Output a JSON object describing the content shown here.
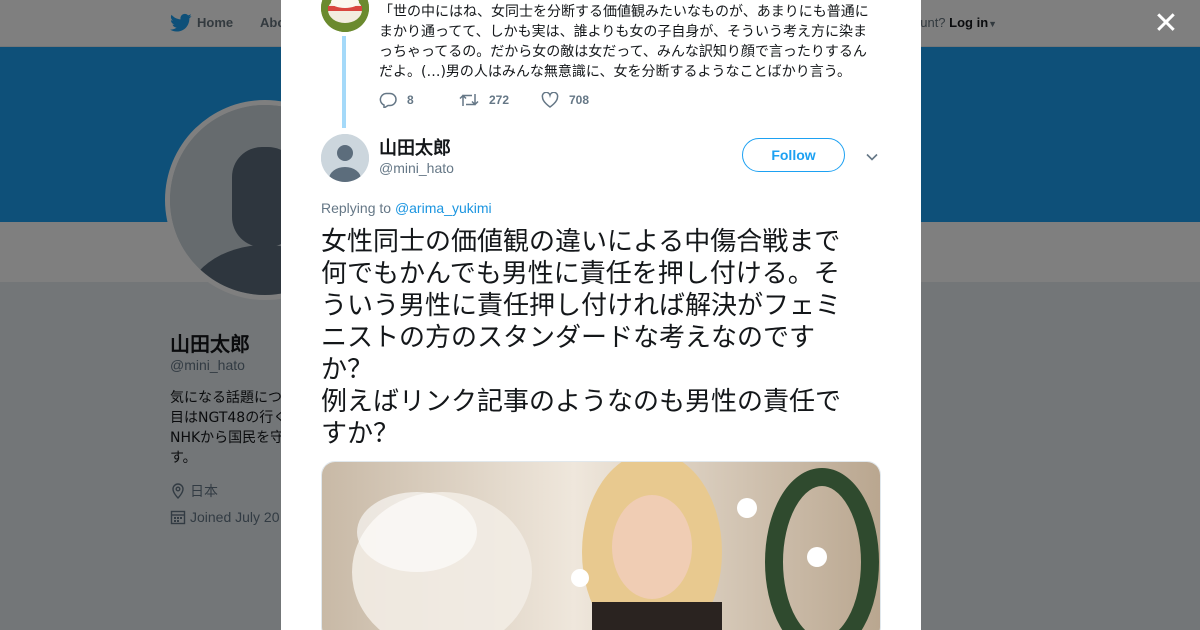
{
  "topnav": {
    "home_label": "Home",
    "about_label": "Abo",
    "account_prompt": "ccount?",
    "login_label": "Log in"
  },
  "profile": {
    "name": "山田太郎",
    "handle": "@mini_hato",
    "bio_lines": [
      "気になる話題につ",
      "目はNGT48の行く",
      "NHKから国民を守",
      "す。"
    ],
    "location": "日本",
    "joined": "Joined July 20"
  },
  "modal": {
    "previous_tweet": {
      "lines": [
        "「世の中にはね、女同士を分断する価値観みたいなものが、あまりにも普通に",
        "まかり通ってて、しかも実は、誰よりも女の子自身が、そういう考え方に染ま",
        "っちゃってるの。だから女の敵は女だって、みんな訳知り顔で言ったりするん",
        "だよ。(…)男の人はみんな無意識に、女を分断するようなことばかり言う。"
      ],
      "replies": "8",
      "retweets": "272",
      "likes": "708"
    },
    "tweet": {
      "author_name": "山田太郎",
      "author_handle": "@mini_hato",
      "follow_label": "Follow",
      "replying_prefix": "Replying to",
      "replying_to": "@arima_yukimi",
      "lines": [
        "女性同士の価値観の違いによる中傷合戦まで",
        "何でもかんでも男性に責任を押し付ける。そ",
        "ういう男性に責任押し付ければ解決がフェミ",
        "ニストの方のスタンダードな考えなのです",
        "か？",
        "例えばリンク記事のようなのも男性の責任で",
        "すか？"
      ]
    }
  },
  "icons": {
    "bird": "twitter-bird-icon",
    "close": "close-icon",
    "reply": "reply-icon",
    "retweet": "retweet-icon",
    "like": "heart-icon",
    "location": "location-pin-icon",
    "calendar": "calendar-icon",
    "caret": "chevron-down-icon"
  },
  "colors": {
    "brand": "#1da1f2",
    "link": "#1b95e0",
    "thread": "#a4d9f9"
  }
}
